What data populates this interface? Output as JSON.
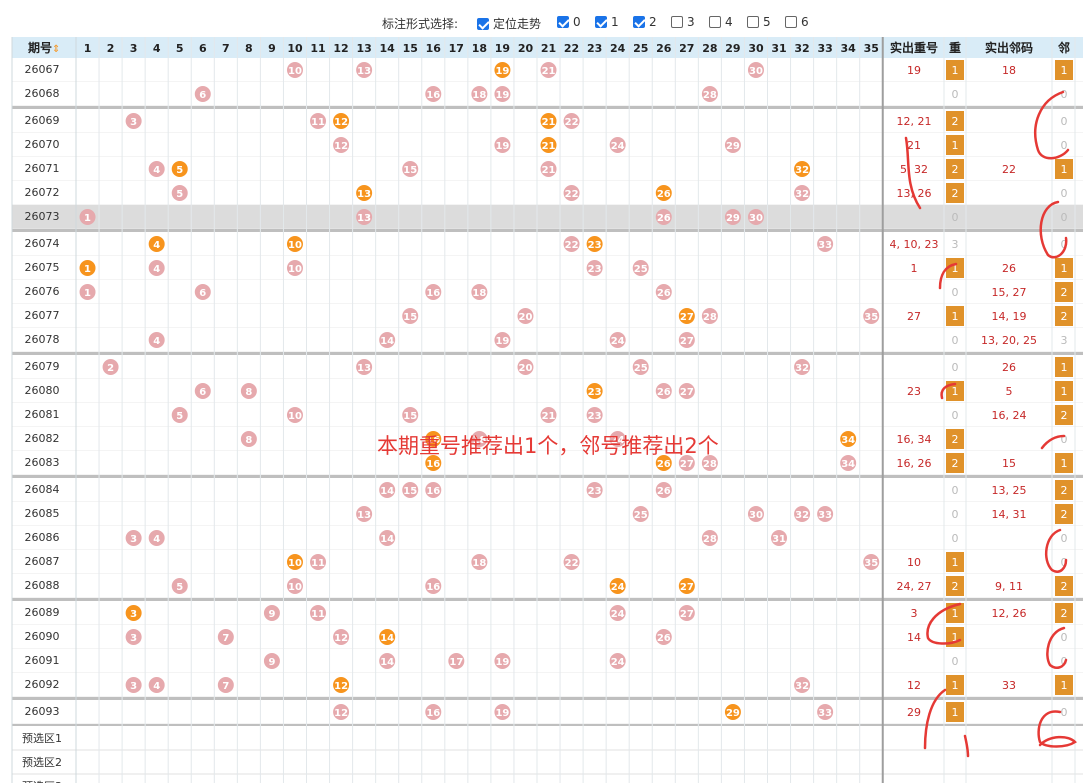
{
  "toolbar": {
    "label": "标注形式选择:",
    "options": [
      {
        "label": "定位走势",
        "checked": true
      },
      {
        "label": "0",
        "checked": true
      },
      {
        "label": "1",
        "checked": true
      },
      {
        "label": "2",
        "checked": true
      },
      {
        "label": "3",
        "checked": false
      },
      {
        "label": "4",
        "checked": false
      },
      {
        "label": "5",
        "checked": false
      },
      {
        "label": "6",
        "checked": false
      }
    ]
  },
  "header": {
    "period": "期号",
    "sort_icon": "sort-arrows-icon",
    "columns": [
      "1",
      "2",
      "3",
      "4",
      "5",
      "6",
      "7",
      "8",
      "9",
      "10",
      "11",
      "12",
      "13",
      "14",
      "15",
      "16",
      "17",
      "18",
      "19",
      "20",
      "21",
      "22",
      "23",
      "24",
      "25",
      "26",
      "27",
      "28",
      "29",
      "30",
      "31",
      "32",
      "33",
      "34",
      "35"
    ],
    "repeat_nums": "实出重号",
    "repeat": "重",
    "neighbor_nums": "实出邻码",
    "neighbor": "邻"
  },
  "colors": {
    "pink_ball": "#e6a9ad",
    "orange_ball": "#f7941d",
    "header_bg": "#d9ecf7",
    "badge": "#e0922a",
    "red_text": "#c62828",
    "annotation": "#e53935"
  },
  "rows": [
    {
      "period": "26067",
      "balls": [
        10,
        13,
        19,
        21,
        30
      ],
      "hot": [
        19
      ],
      "repeat_nums": "19",
      "repeat": "1",
      "neighbor_nums": "18",
      "neighbor": "1"
    },
    {
      "period": "26068",
      "balls": [
        6,
        16,
        18,
        19,
        28
      ],
      "hot": [],
      "repeat_nums": "",
      "repeat": "0",
      "neighbor_nums": "",
      "neighbor": "0"
    },
    {
      "period": "26069",
      "balls": [
        3,
        11,
        12,
        21,
        22
      ],
      "hot": [
        12,
        21
      ],
      "repeat_nums": "12, 21",
      "repeat": "2",
      "neighbor_nums": "",
      "neighbor": "0"
    },
    {
      "period": "26070",
      "balls": [
        12,
        19,
        21,
        24,
        29
      ],
      "hot": [
        21
      ],
      "repeat_nums": "21",
      "repeat": "1",
      "neighbor_nums": "",
      "neighbor": "0"
    },
    {
      "period": "26071",
      "balls": [
        4,
        5,
        15,
        21,
        32
      ],
      "hot": [
        5,
        32
      ],
      "repeat_nums": "5, 32",
      "repeat": "2",
      "neighbor_nums": "22",
      "neighbor": "1"
    },
    {
      "period": "26072",
      "balls": [
        5,
        13,
        22,
        26,
        32
      ],
      "hot": [
        13,
        26
      ],
      "repeat_nums": "13, 26",
      "repeat": "2",
      "neighbor_nums": "",
      "neighbor": "0"
    },
    {
      "period": "26073",
      "balls": [
        1,
        13,
        26,
        29,
        30
      ],
      "hot": [],
      "repeat_nums": "",
      "repeat": "0",
      "neighbor_nums": "",
      "neighbor": "0"
    },
    {
      "period": "26074",
      "balls": [
        4,
        10,
        22,
        23,
        33
      ],
      "hot": [
        4,
        10,
        23
      ],
      "repeat_nums": "4, 10, 23",
      "repeat": "3",
      "neighbor_nums": "",
      "neighbor": "0"
    },
    {
      "period": "26075",
      "balls": [
        1,
        4,
        10,
        23,
        25
      ],
      "hot": [
        1
      ],
      "repeat_nums": "1",
      "repeat": "1",
      "neighbor_nums": "26",
      "neighbor": "1"
    },
    {
      "period": "26076",
      "balls": [
        1,
        6,
        16,
        18,
        26
      ],
      "hot": [],
      "repeat_nums": "",
      "repeat": "0",
      "neighbor_nums": "15, 27",
      "neighbor": "2"
    },
    {
      "period": "26077",
      "balls": [
        15,
        20,
        27,
        28,
        35
      ],
      "hot": [
        27
      ],
      "repeat_nums": "27",
      "repeat": "1",
      "neighbor_nums": "14, 19",
      "neighbor": "2"
    },
    {
      "period": "26078",
      "balls": [
        4,
        14,
        19,
        24,
        27
      ],
      "hot": [],
      "repeat_nums": "",
      "repeat": "0",
      "neighbor_nums": "13, 20, 25",
      "neighbor": "3"
    },
    {
      "period": "26079",
      "balls": [
        2,
        13,
        20,
        25,
        32
      ],
      "hot": [],
      "repeat_nums": "",
      "repeat": "0",
      "neighbor_nums": "26",
      "neighbor": "1"
    },
    {
      "period": "26080",
      "balls": [
        6,
        8,
        23,
        26,
        27
      ],
      "hot": [
        23
      ],
      "repeat_nums": "23",
      "repeat": "1",
      "neighbor_nums": "5",
      "neighbor": "1"
    },
    {
      "period": "26081",
      "balls": [
        5,
        10,
        15,
        21,
        23
      ],
      "hot": [],
      "repeat_nums": "",
      "repeat": "0",
      "neighbor_nums": "16, 24",
      "neighbor": "2"
    },
    {
      "period": "26082",
      "balls": [
        8,
        16,
        18,
        24,
        34
      ],
      "hot": [
        16,
        34
      ],
      "repeat_nums": "16, 34",
      "repeat": "2",
      "neighbor_nums": "",
      "neighbor": "0"
    },
    {
      "period": "26083",
      "balls": [
        16,
        26,
        27,
        28,
        34
      ],
      "hot": [
        16,
        26
      ],
      "repeat_nums": "16, 26",
      "repeat": "2",
      "neighbor_nums": "15",
      "neighbor": "1"
    },
    {
      "period": "26084",
      "balls": [
        14,
        15,
        16,
        23,
        26
      ],
      "hot": [],
      "repeat_nums": "",
      "repeat": "0",
      "neighbor_nums": "13, 25",
      "neighbor": "2"
    },
    {
      "period": "26085",
      "balls": [
        13,
        25,
        30,
        32,
        33
      ],
      "hot": [],
      "repeat_nums": "",
      "repeat": "0",
      "neighbor_nums": "14, 31",
      "neighbor": "2"
    },
    {
      "period": "26086",
      "balls": [
        3,
        4,
        14,
        28,
        31
      ],
      "hot": [],
      "repeat_nums": "",
      "repeat": "0",
      "neighbor_nums": "",
      "neighbor": "0"
    },
    {
      "period": "26087",
      "balls": [
        10,
        11,
        18,
        22,
        35
      ],
      "hot": [
        10
      ],
      "repeat_nums": "10",
      "repeat": "1",
      "neighbor_nums": "",
      "neighbor": "0"
    },
    {
      "period": "26088",
      "balls": [
        5,
        10,
        16,
        24,
        27
      ],
      "hot": [
        24,
        27
      ],
      "repeat_nums": "24, 27",
      "repeat": "2",
      "neighbor_nums": "9, 11",
      "neighbor": "2"
    },
    {
      "period": "26089",
      "balls": [
        3,
        9,
        11,
        24,
        27
      ],
      "hot": [
        3
      ],
      "repeat_nums": "3",
      "repeat": "1",
      "neighbor_nums": "12, 26",
      "neighbor": "2"
    },
    {
      "period": "26090",
      "balls": [
        3,
        7,
        12,
        14,
        26
      ],
      "hot": [
        14
      ],
      "repeat_nums": "14",
      "repeat": "1",
      "neighbor_nums": "",
      "neighbor": "0"
    },
    {
      "period": "26091",
      "balls": [
        9,
        14,
        17,
        19,
        24
      ],
      "hot": [],
      "repeat_nums": "",
      "repeat": "0",
      "neighbor_nums": "",
      "neighbor": "0"
    },
    {
      "period": "26092",
      "balls": [
        3,
        4,
        7,
        12,
        32
      ],
      "hot": [
        12
      ],
      "repeat_nums": "12",
      "repeat": "1",
      "neighbor_nums": "33",
      "neighbor": "1"
    },
    {
      "period": "26093",
      "balls": [
        12,
        16,
        19,
        29,
        33
      ],
      "hot": [
        29
      ],
      "repeat_nums": "29",
      "repeat": "1",
      "neighbor_nums": "",
      "neighbor": "0"
    }
  ],
  "preselect": [
    "预选区1",
    "预选区2",
    "预选区3"
  ],
  "annotation": "本期重号推荐出1个，邻号推荐出2个"
}
